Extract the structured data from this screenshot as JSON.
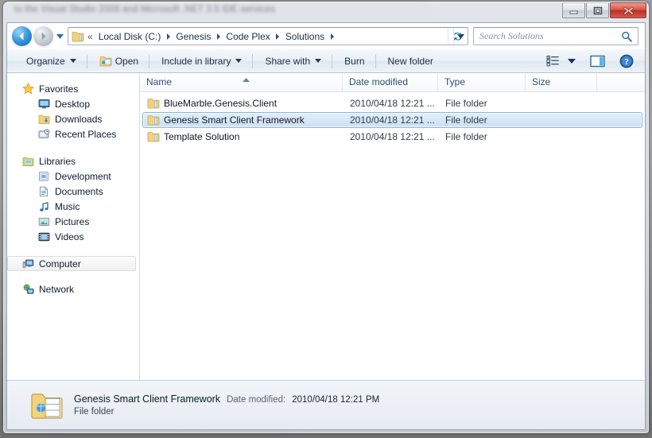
{
  "window": {
    "title_blurred": "to the Visual Studio 2008 and Microsoft .NET 3.5 IDE services",
    "controls": {
      "minimize": "Minimize",
      "restore": "Restore Down",
      "close": "Close"
    }
  },
  "addressbar": {
    "back_label": "Back",
    "forward_label": "Forward",
    "history_label": "Recent pages",
    "folder_icon": "folder-icon",
    "overflow": "«",
    "crumbs": [
      "Local Disk (C:)",
      "Genesis",
      "Code Plex",
      "Solutions"
    ],
    "dropdown_label": "Previous locations",
    "refresh_label": "Refresh"
  },
  "search": {
    "placeholder": "Search Solutions",
    "value": "",
    "icon": "search-icon"
  },
  "toolbar": {
    "organize": "Organize",
    "open": "Open",
    "include_in_library": "Include in library",
    "share_with": "Share with",
    "burn": "Burn",
    "new_folder": "New folder",
    "view_options_label": "Change your view",
    "preview_pane_label": "Show the preview pane",
    "help_label": "Get help"
  },
  "navpane": {
    "groups": [
      {
        "header": "Favorites",
        "icon": "star-icon",
        "items": [
          {
            "label": "Desktop",
            "icon": "desktop-icon"
          },
          {
            "label": "Downloads",
            "icon": "downloads-folder-icon"
          },
          {
            "label": "Recent Places",
            "icon": "recent-places-icon"
          }
        ]
      },
      {
        "header": "Libraries",
        "icon": "libraries-icon",
        "items": [
          {
            "label": "Development",
            "icon": "development-library-icon"
          },
          {
            "label": "Documents",
            "icon": "documents-library-icon"
          },
          {
            "label": "Music",
            "icon": "music-library-icon"
          },
          {
            "label": "Pictures",
            "icon": "pictures-library-icon"
          },
          {
            "label": "Videos",
            "icon": "videos-library-icon"
          }
        ]
      },
      {
        "header": "Computer",
        "icon": "computer-icon",
        "hovered": true,
        "items": []
      },
      {
        "header": "Network",
        "icon": "network-icon",
        "items": []
      }
    ]
  },
  "filelist": {
    "columns": [
      {
        "key": "name",
        "label": "Name",
        "sorted": "asc"
      },
      {
        "key": "date",
        "label": "Date modified"
      },
      {
        "key": "type",
        "label": "Type"
      },
      {
        "key": "size",
        "label": "Size"
      }
    ],
    "rows": [
      {
        "name": "BlueMarble.Genesis.Client",
        "date": "2010/04/18 12:21 ...",
        "type": "File folder",
        "size": "",
        "icon": "folder-icon",
        "selected": false
      },
      {
        "name": "Genesis Smart Client Framework",
        "date": "2010/04/18 12:21 ...",
        "type": "File folder",
        "size": "",
        "icon": "folder-icon",
        "selected": true
      },
      {
        "name": "Template Solution",
        "date": "2010/04/18 12:21 ...",
        "type": "File folder",
        "size": "",
        "icon": "folder-icon",
        "selected": false
      }
    ]
  },
  "details": {
    "icon": "open-folder-icon",
    "title": "Genesis Smart Client Framework",
    "date_label": "Date modified:",
    "date_value": "2010/04/18 12:21 PM",
    "type": "File folder"
  },
  "colors": {
    "selection_border": "#8ab6e0",
    "selection_fill": "#ccdff5",
    "close_button": "#bc2f25",
    "crumb_text": "#1b2f45",
    "folder_yellow": "#f5d78a"
  }
}
